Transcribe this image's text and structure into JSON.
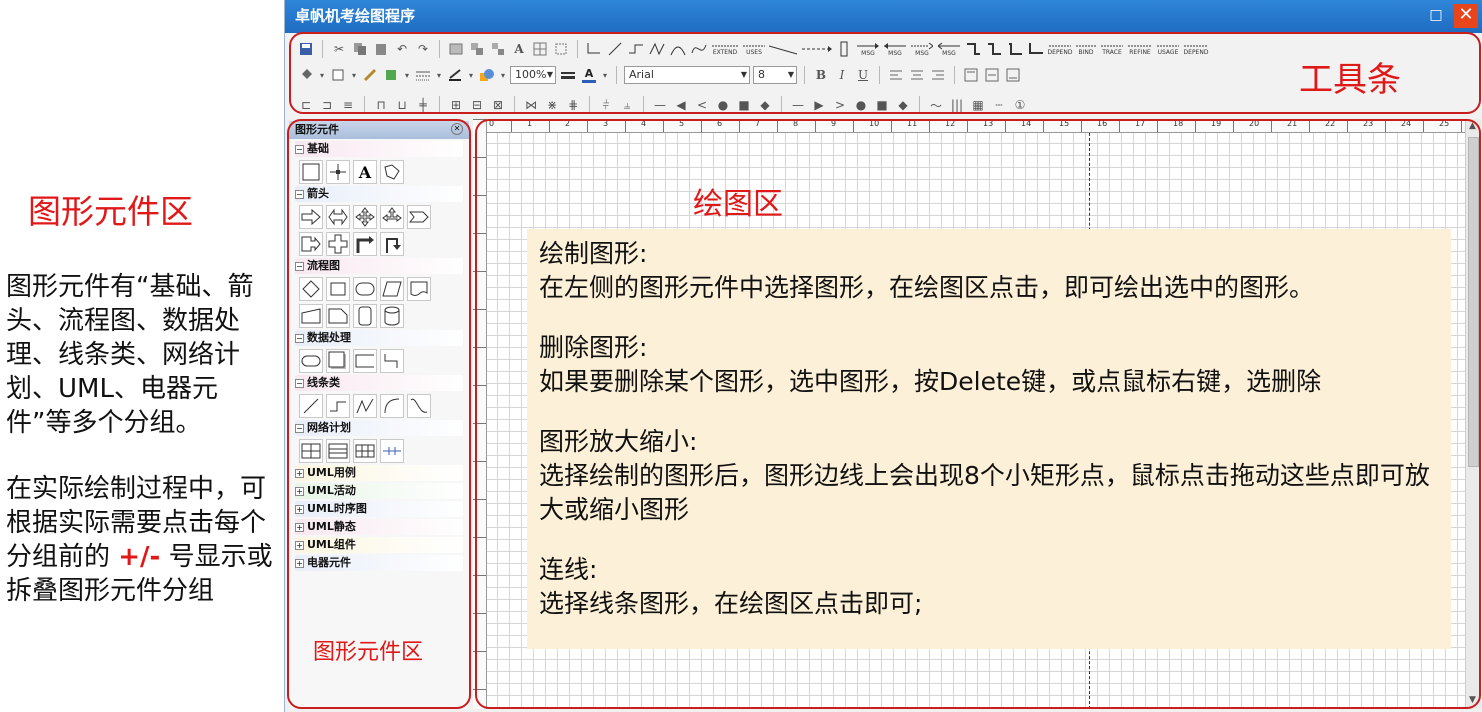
{
  "description": {
    "title": "图形元件区",
    "para1": "图形元件有“基础、箭头、流程图、数据处理、线条类、网络计划、UML、电器元件”等多个分组。",
    "para2_before": "在实际绘制过程中，可根据实际需要点击每个分组前的 ",
    "para2_sign": "+/-",
    "para2_after": " 号显示或拆叠图形元件分组"
  },
  "window": {
    "title": "卓帆机考绘图程序",
    "max_glyph": "□",
    "close_glyph": "✕"
  },
  "toolbar": {
    "annotation_label": "工具条",
    "zoom_value": "100%",
    "font_name": "Arial",
    "font_size": "8",
    "bold": "B",
    "italic": "I",
    "underline": "U",
    "uml_labels": [
      "EXTEND",
      "USES",
      "MSG",
      "MSG",
      "MSG",
      "MSG",
      "DEPEND",
      "BIND",
      "TRACE",
      "REFINE",
      "USAGE",
      "DEPEND"
    ],
    "line_number_glyph": "①"
  },
  "panel": {
    "header": "图形元件",
    "annotation_label": "图形元件区",
    "groups": [
      {
        "sign": "−",
        "name": "基础"
      },
      {
        "sign": "−",
        "name": "箭头"
      },
      {
        "sign": "−",
        "name": "流程图"
      },
      {
        "sign": "−",
        "name": "数据处理"
      },
      {
        "sign": "−",
        "name": "线条类"
      },
      {
        "sign": "−",
        "name": "网络计划"
      },
      {
        "sign": "+",
        "name": "UML用例"
      },
      {
        "sign": "+",
        "name": "UML活动"
      },
      {
        "sign": "+",
        "name": "UML时序图"
      },
      {
        "sign": "+",
        "name": "UML静态"
      },
      {
        "sign": "+",
        "name": "UML组件"
      },
      {
        "sign": "+",
        "name": "电器元件"
      }
    ],
    "text_tool": "A"
  },
  "canvas": {
    "annotation_label": "绘图区",
    "ruler_marks": [
      "0",
      "1",
      "2",
      "3",
      "4",
      "5",
      "6",
      "7",
      "8",
      "9",
      "10",
      "11",
      "12",
      "13",
      "14",
      "15",
      "16",
      "17",
      "18",
      "19",
      "20",
      "21",
      "22",
      "23",
      "24",
      "25"
    ],
    "notes": [
      {
        "heading": "绘制图形:",
        "text": "在左侧的图形元件中选择图形，在绘图区点击，即可绘出选中的图形。"
      },
      {
        "heading": "删除图形:",
        "text": "如果要删除某个图形，选中图形，按Delete键，或点鼠标右键，选删除"
      },
      {
        "heading": "图形放大缩小:",
        "text": "选择绘制的图形后，图形边线上会出现8个小矩形点，鼠标点击拖动这些点即可放大或缩小图形"
      },
      {
        "heading": "连线:",
        "text": "选择线条图形，在绘图区点击即可;"
      }
    ]
  },
  "colors": {
    "annotation_red": "#e01818",
    "titlebar_blue": "#2f86d8",
    "note_bg": "#fdf0d8"
  }
}
